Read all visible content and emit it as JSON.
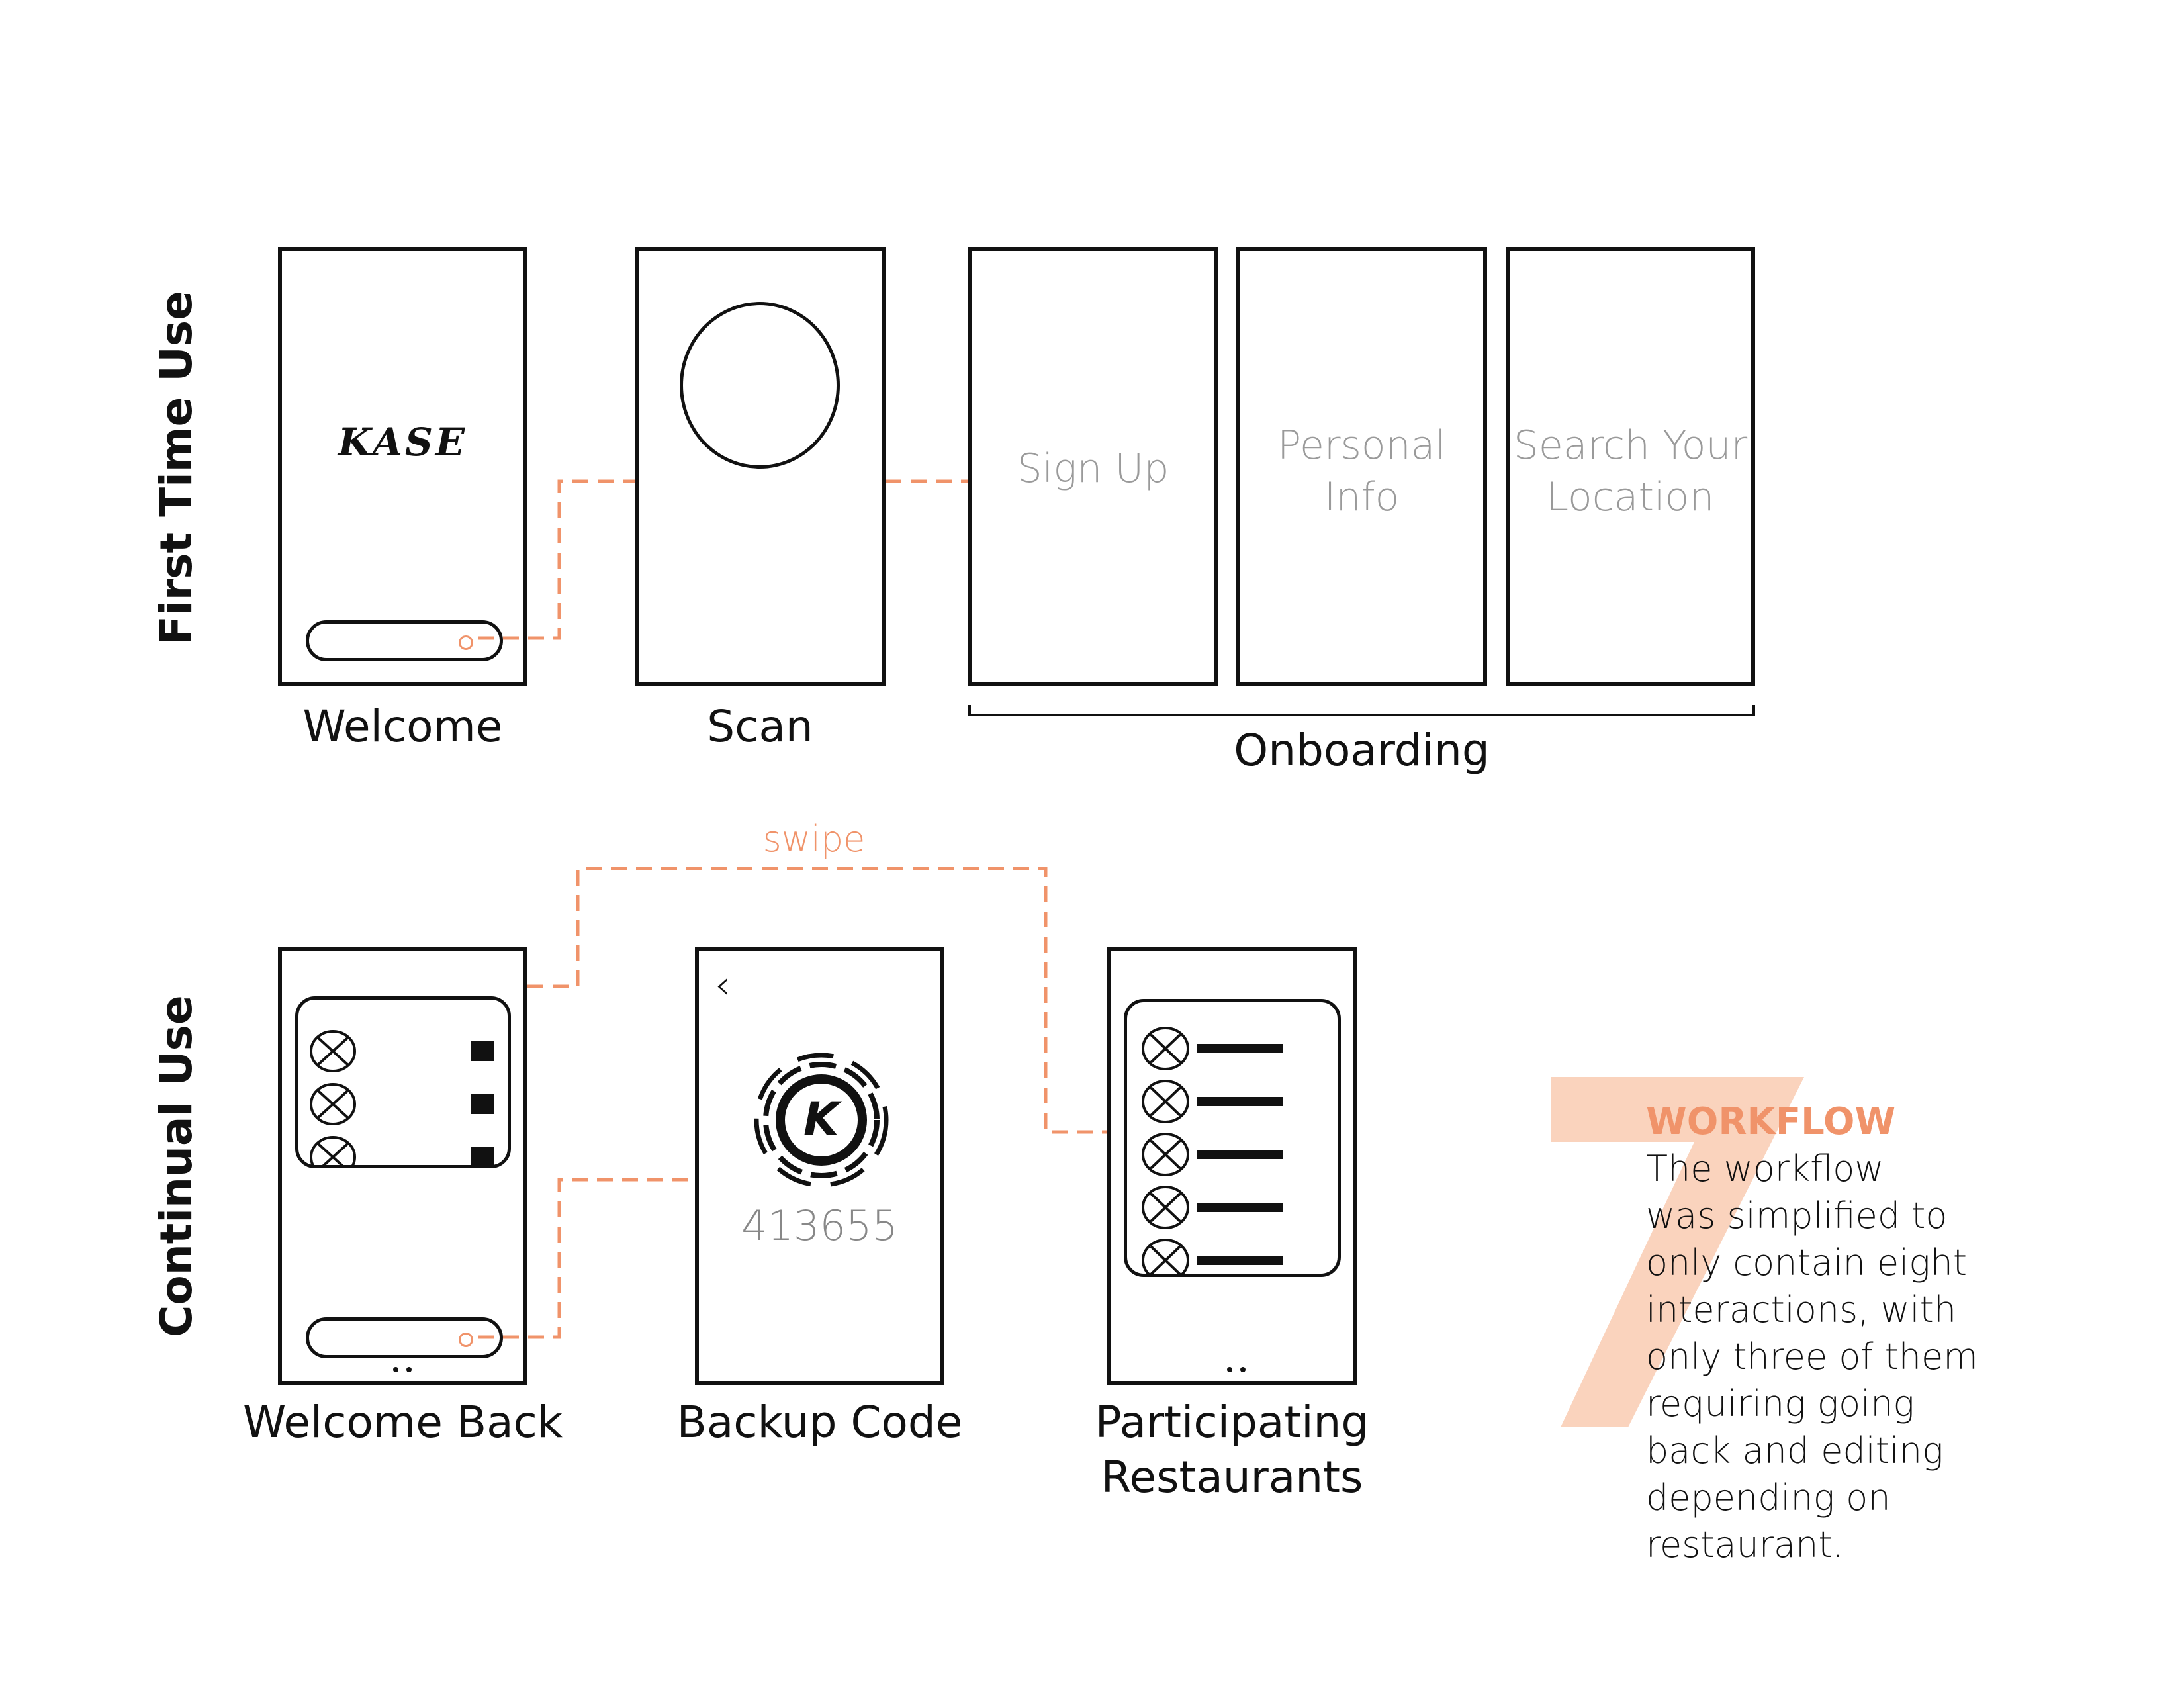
{
  "rows": {
    "first_time": "First Time Use",
    "continual": "Continual Use"
  },
  "screens": {
    "welcome": {
      "caption": "Welcome",
      "logo": "KASE"
    },
    "scan": {
      "caption": "Scan"
    },
    "sign_up": {
      "text": "Sign Up"
    },
    "personal_info": {
      "text": "Personal\nInfo"
    },
    "search_location": {
      "text": "Search Your\nLocation"
    },
    "onboarding": {
      "caption": "Onboarding"
    },
    "welcome_back": {
      "caption": "Welcome Back"
    },
    "backup_code": {
      "caption": "Backup Code",
      "code": "413655",
      "logo_letter": "K",
      "back_icon": "chevron-left-icon"
    },
    "participating": {
      "caption": "Participating\nRestaurants"
    }
  },
  "connector_label": "swipe",
  "workflow": {
    "number": "7",
    "title": "WORKFLOW",
    "body": "The workflow\nwas simplified to\nonly contain eight\ninteractions, with\nonly three of them\nrequiring going\nback and editing\ndepending on\nrestaurant."
  },
  "colors": {
    "accent": "#F0936A",
    "accent_light": "#FAD3BD",
    "line": "#111111"
  }
}
